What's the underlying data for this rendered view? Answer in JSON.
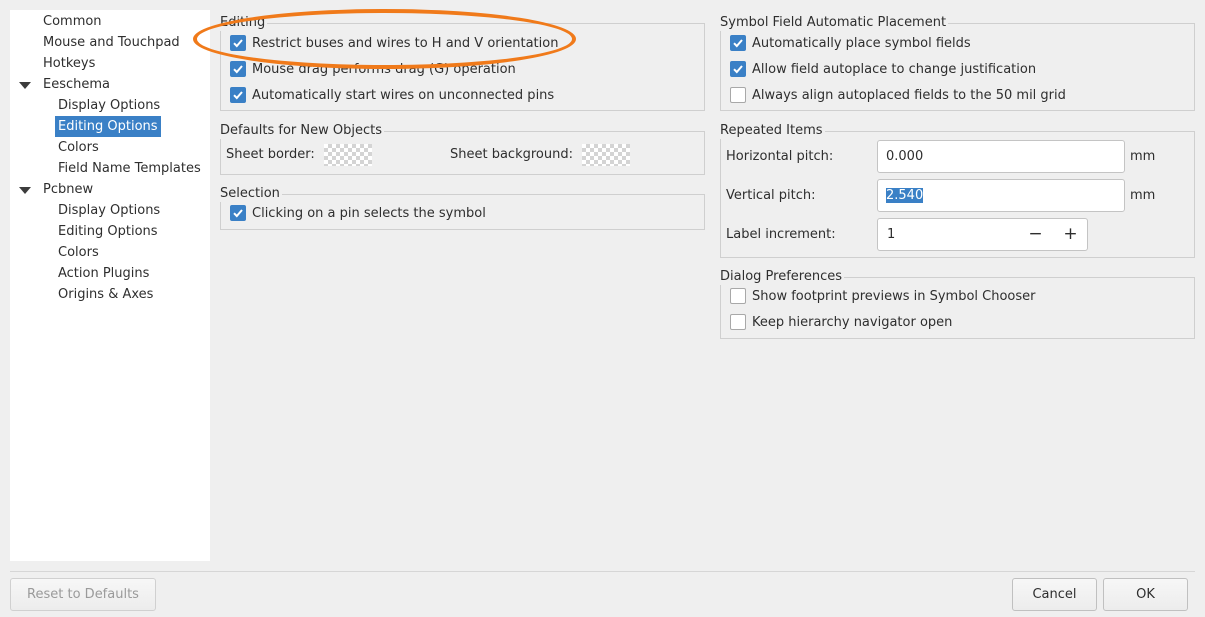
{
  "tree": {
    "items": [
      {
        "label": "Common"
      },
      {
        "label": "Mouse and Touchpad"
      },
      {
        "label": "Hotkeys"
      },
      {
        "label": "Eeschema"
      },
      {
        "label": "Display Options"
      },
      {
        "label": "Editing Options"
      },
      {
        "label": "Colors"
      },
      {
        "label": "Field Name Templates"
      },
      {
        "label": "Pcbnew"
      },
      {
        "label": "Display Options"
      },
      {
        "label": "Editing Options"
      },
      {
        "label": "Colors"
      },
      {
        "label": "Action Plugins"
      },
      {
        "label": "Origins & Axes"
      }
    ],
    "selected": "Editing Options"
  },
  "editing": {
    "title": "Editing",
    "options": [
      {
        "label": "Restrict buses and wires to H and V orientation",
        "checked": true
      },
      {
        "label": "Mouse drag performs drag (G) operation",
        "checked": true
      },
      {
        "label": "Automatically start wires on unconnected pins",
        "checked": true
      }
    ]
  },
  "defaults": {
    "title": "Defaults for New Objects",
    "sheet_border_label": "Sheet border:",
    "sheet_background_label": "Sheet background:"
  },
  "selection": {
    "title": "Selection",
    "options": [
      {
        "label": "Clicking on a pin selects the symbol",
        "checked": true
      }
    ]
  },
  "field_placement": {
    "title": "Symbol Field Automatic Placement",
    "options": [
      {
        "label": "Automatically place symbol fields",
        "checked": true
      },
      {
        "label": "Allow field autoplace to change justification",
        "checked": true
      },
      {
        "label": "Always align autoplaced fields to the 50 mil grid",
        "checked": false
      }
    ]
  },
  "repeated": {
    "title": "Repeated Items",
    "horizontal_pitch_label": "Horizontal pitch:",
    "horizontal_pitch_value": "0.000",
    "horizontal_unit": "mm",
    "vertical_pitch_label": "Vertical pitch:",
    "vertical_pitch_value": "2.540",
    "vertical_unit": "mm",
    "label_increment_label": "Label increment:",
    "label_increment_value": "1",
    "minus": "−",
    "plus": "+"
  },
  "dialog_prefs": {
    "title": "Dialog Preferences",
    "options": [
      {
        "label": "Show footprint previews in Symbol Chooser",
        "checked": false
      },
      {
        "label": "Keep hierarchy navigator open",
        "checked": false
      }
    ]
  },
  "buttons": {
    "reset": "Reset to Defaults",
    "cancel": "Cancel",
    "ok": "OK"
  },
  "colors": {
    "accent": "#3a80c6",
    "annotation": "#f07a1a"
  }
}
